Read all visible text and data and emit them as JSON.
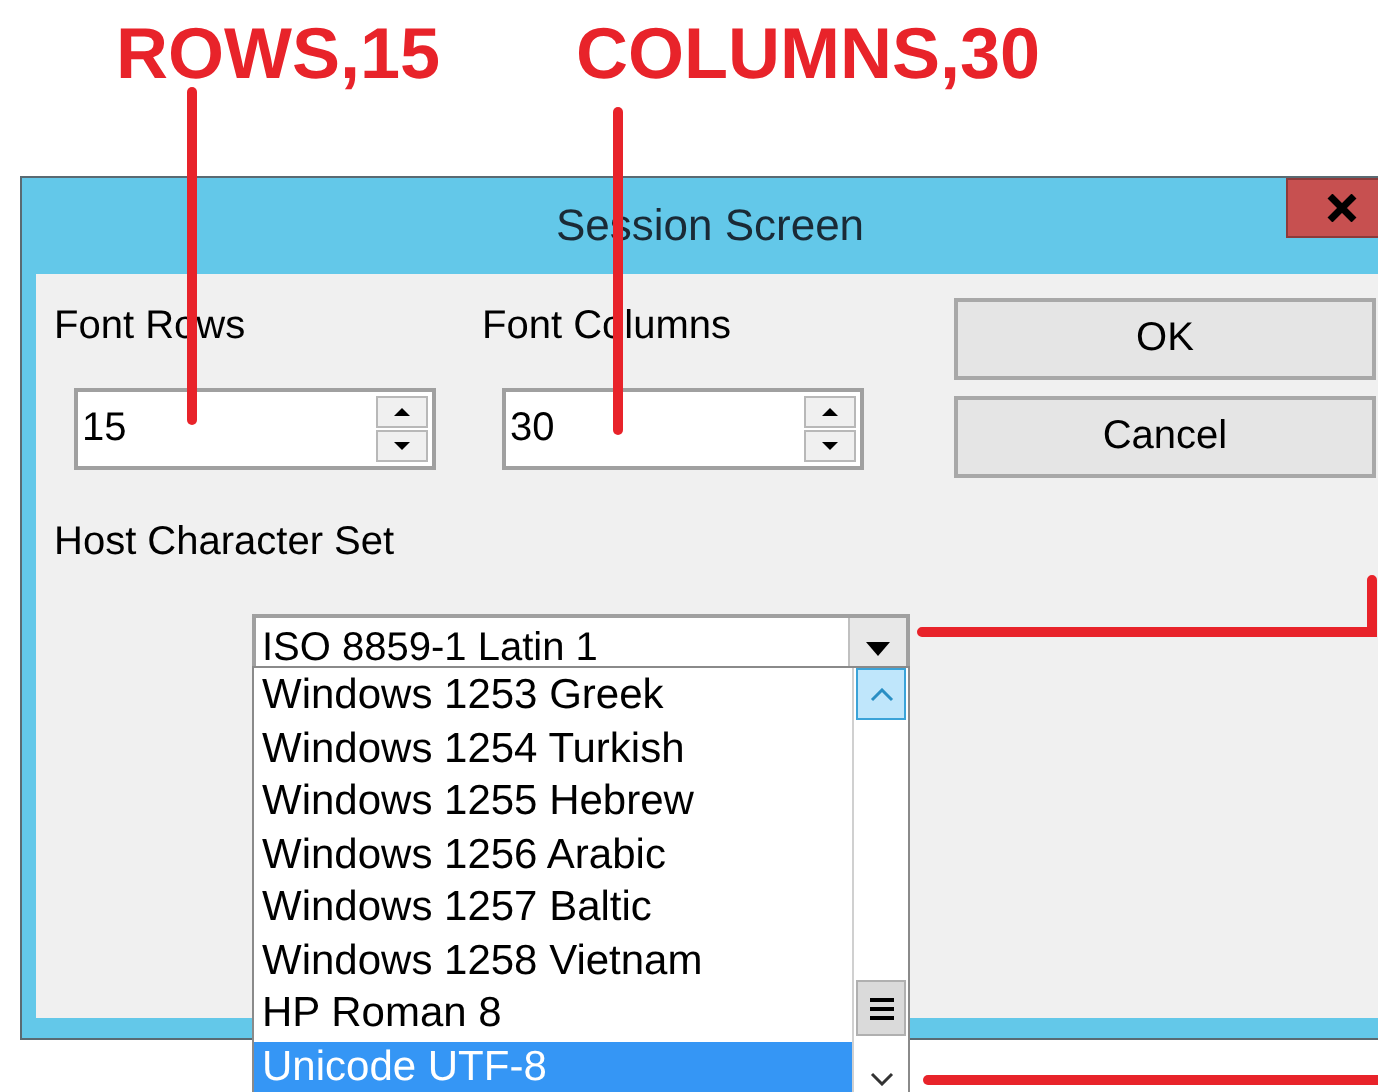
{
  "annotations": [
    {
      "text": "ROWS,15"
    },
    {
      "text": "COLUMNS,30"
    }
  ],
  "window": {
    "title": "Session Screen"
  },
  "fields": [
    {
      "label": "Font Rows",
      "value": "15"
    },
    {
      "label": "Font Columns",
      "value": "30"
    }
  ],
  "buttons": [
    "OK",
    "Cancel"
  ],
  "charset": {
    "label": "Host Character Set",
    "value": "ISO 8859-1 Latin 1",
    "expanded": true,
    "options": [
      {
        "label": "Windows 1253 Greek",
        "selected": false
      },
      {
        "label": "Windows 1254 Turkish",
        "selected": false
      },
      {
        "label": "Windows 1255 Hebrew",
        "selected": false
      },
      {
        "label": "Windows 1256 Arabic",
        "selected": false
      },
      {
        "label": "Windows 1257 Baltic",
        "selected": false
      },
      {
        "label": "Windows 1258 Vietnam",
        "selected": false
      },
      {
        "label": "HP Roman 8",
        "selected": false
      },
      {
        "label": "Unicode UTF-8",
        "selected": true
      }
    ]
  }
}
